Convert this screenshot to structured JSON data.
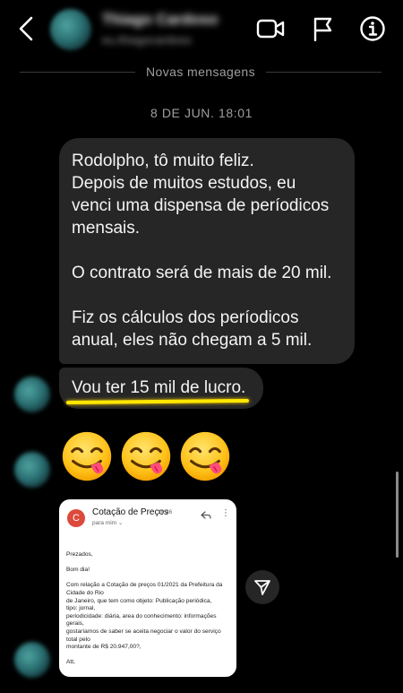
{
  "header": {
    "contact_name": "Thiago Cardoso",
    "contact_username": "eu.thiagocardoso",
    "icons": [
      "chevron-left-icon",
      "video-camera-icon",
      "flag-icon",
      "info-icon"
    ]
  },
  "separator": {
    "label": "Novas mensagens"
  },
  "timestamp": "8 DE JUN. 18:01",
  "messages": {
    "main": {
      "line1": "Rodolpho, tô muito feliz.",
      "line2": "Depois de muitos estudos, eu",
      "line3": "venci uma dispensa de períodicos",
      "line4": "mensais.",
      "line5": "O contrato será de mais de 20 mil.",
      "line6": "Fiz os cálculos dos períodicos",
      "line7": "anual, eles não chegam a 5 mil."
    },
    "highlighted": "Vou ter 15 mil de lucro.",
    "highlight_color": "#ffe600",
    "emojis": [
      "😋",
      "😋",
      "😋"
    ]
  },
  "email": {
    "avatar_letter": "C",
    "avatar_color": "#dc4a3c",
    "subject": "Cotação de Preços",
    "time": "10:36",
    "to": "para mim",
    "body": {
      "l1": "Prezados,",
      "l2": "Bom dia!",
      "l3": "Com relação a Cotação de preços 01/2021 da Prefeitura da",
      "l4": "Cidade do Rio",
      "l5": "de Janeiro, que tem como objeto: Publicação periódica,",
      "l6": "tipo: jornal,",
      "l7": "periodicidade: diária, area do conhecimento: informações",
      "l8": "gerais,",
      "l9": "gostaríamos de saber se aceita negociar o valor do serviço",
      "l10": "total pelo",
      "l11": "montante de R$ 20.947,00?,",
      "l12": "Att,"
    }
  },
  "colors": {
    "background": "#000000",
    "bubble": "#262626",
    "secondary_text": "#9e9e9e"
  }
}
